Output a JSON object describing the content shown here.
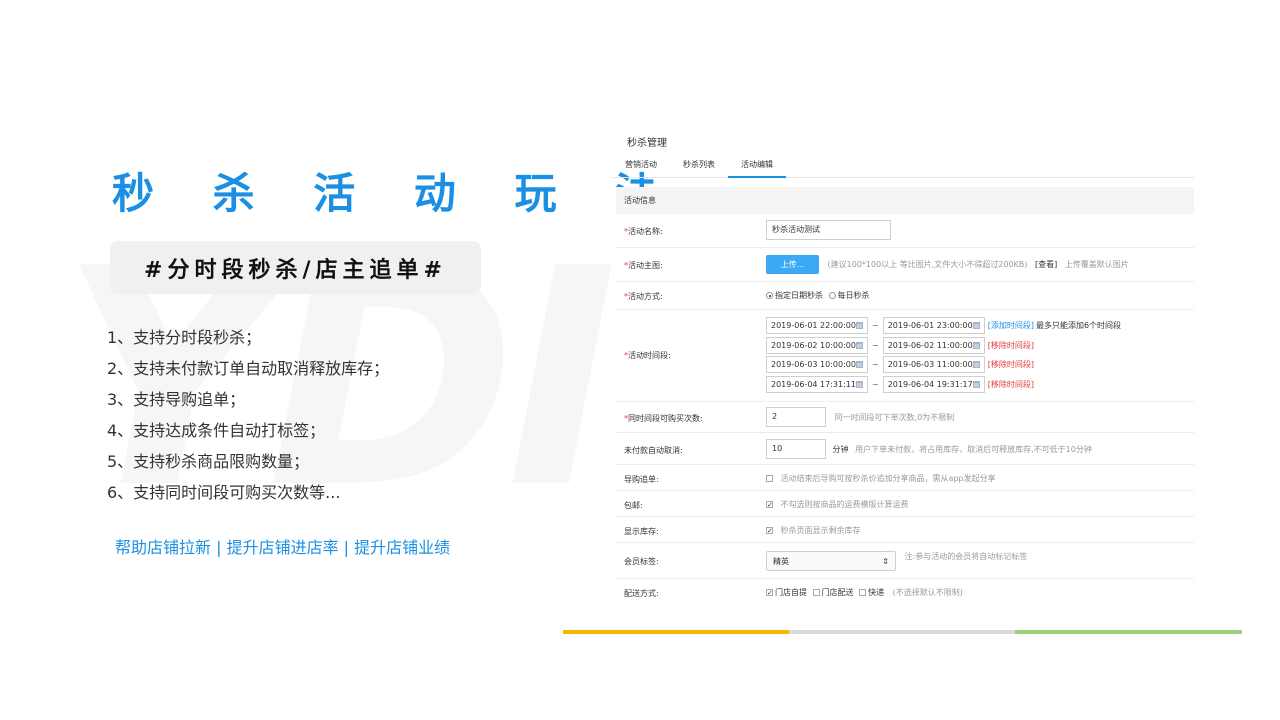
{
  "left": {
    "title": "秒 杀 活 动 玩 法",
    "tag": "#分时段秒杀/店主追单#",
    "features": [
      "1、支持分时段秒杀；",
      "2、支持未付款订单自动取消释放库存；",
      "3、支持导购追单；",
      "4、支持达成条件自动打标签；",
      "5、支持秒杀商品限购数量；",
      "6、支持同时间段可购买次数等..."
    ],
    "tagline": "帮助店铺拉新 | 提升店铺进店率 | 提升店铺业绩"
  },
  "panel": {
    "title": "秒杀管理",
    "tabs": [
      "营销活动",
      "秒杀列表",
      "活动编辑"
    ],
    "active_tab": "活动编辑",
    "section": "活动信息",
    "rows": {
      "name": {
        "label": "活动名称:",
        "value": "秒杀活动测试"
      },
      "image": {
        "label": "活动主图:",
        "button": "上传...",
        "hint": "(建议100*100以上 等比图片,文件大小不得超过200KB)",
        "view": "[查看]",
        "hint2": "上传覆盖默认图片"
      },
      "mode": {
        "label": "活动方式:",
        "option1": "指定日期秒杀",
        "option2": "每日秒杀",
        "selected": "指定日期秒杀"
      },
      "periods": {
        "label": "活动时间段:",
        "items": [
          {
            "start": "2019-06-01 22:00:00",
            "end": "2019-06-01 23:00:00",
            "action": "[添加时间段]",
            "note": "最多只能添加6个时间段"
          },
          {
            "start": "2019-06-02 10:00:00",
            "end": "2019-06-02 11:00:00",
            "action": "[移除时间段]"
          },
          {
            "start": "2019-06-03 10:00:00",
            "end": "2019-06-03 11:00:00",
            "action": "[移除时间段]"
          },
          {
            "start": "2019-06-04 17:31:11",
            "end": "2019-06-04 19:31:17",
            "action": "[移除时间段]"
          }
        ],
        "tilde": "~"
      },
      "limit": {
        "label": "同时间段可购买次数:",
        "value": "2",
        "hint": "同一时间段可下单次数,0为不限制"
      },
      "cancel": {
        "label": "未付款自动取消:",
        "value": "10",
        "unit": "分钟",
        "hint": "用户下单未付款，将占用库存，取消后可释放库存,不可低于10分钟"
      },
      "guide": {
        "label": "导购追单:",
        "checked": false,
        "hint": "活动结束后导购可按秒杀价追加分享商品，需从app发起分享"
      },
      "shipping_fee": {
        "label": "包邮:",
        "checked": true,
        "hint": "不勾选则按商品的运费模版计算运费"
      },
      "stock": {
        "label": "显示库存:",
        "checked": true,
        "hint": "秒杀页面显示剩余库存"
      },
      "member_tag": {
        "label": "会员标签:",
        "value": "精英",
        "hint": "注:参与活动的会员将自动标记标签"
      },
      "delivery": {
        "label": "配送方式:",
        "options": [
          {
            "label": "门店自提",
            "checked": true
          },
          {
            "label": "门店配送",
            "checked": false
          },
          {
            "label": "快递",
            "checked": false
          }
        ],
        "hint": "(不选择默认不限制)"
      }
    }
  },
  "colors": {
    "accent": "#1a8fe3",
    "bar_yellow": "#f5b800",
    "bar_gray": "#d9d9d9",
    "bar_green": "#a3cf7c"
  },
  "watermark": "YDI"
}
